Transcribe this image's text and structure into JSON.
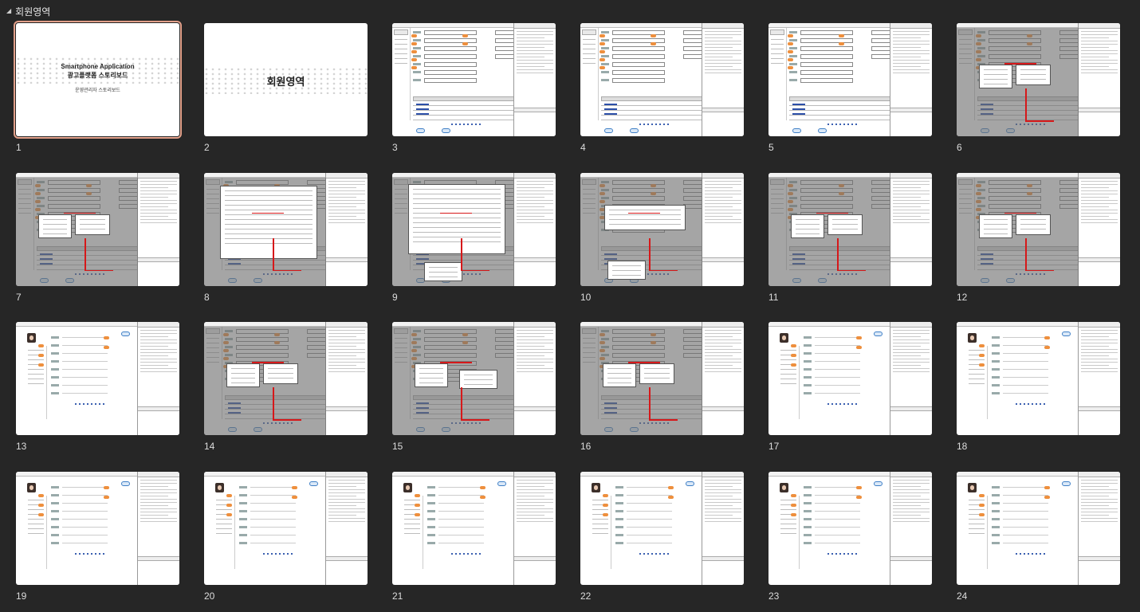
{
  "section": {
    "title": "회원영역",
    "collapse_glyph": "◢"
  },
  "title_slides": {
    "s1": {
      "line1": "Smartphone Application",
      "line2": "광고플랫폼 스토리보드",
      "line3": "운영관리자 스토리보드"
    },
    "s2": {
      "title": "회원영역"
    }
  },
  "slides": [
    {
      "n": "1",
      "kind": "title1"
    },
    {
      "n": "2",
      "kind": "title2"
    },
    {
      "n": "3",
      "kind": "form"
    },
    {
      "n": "4",
      "kind": "form"
    },
    {
      "n": "5",
      "kind": "form"
    },
    {
      "n": "6",
      "kind": "overlay"
    },
    {
      "n": "7",
      "kind": "overlay"
    },
    {
      "n": "8",
      "kind": "overlay"
    },
    {
      "n": "9",
      "kind": "overlay"
    },
    {
      "n": "10",
      "kind": "overlay"
    },
    {
      "n": "11",
      "kind": "overlay"
    },
    {
      "n": "12",
      "kind": "overlay"
    },
    {
      "n": "13",
      "kind": "profile"
    },
    {
      "n": "14",
      "kind": "overlay"
    },
    {
      "n": "15",
      "kind": "overlay"
    },
    {
      "n": "16",
      "kind": "overlay"
    },
    {
      "n": "17",
      "kind": "profile"
    },
    {
      "n": "18",
      "kind": "profile"
    },
    {
      "n": "19",
      "kind": "profile"
    },
    {
      "n": "20",
      "kind": "profile"
    },
    {
      "n": "21",
      "kind": "profile"
    },
    {
      "n": "22",
      "kind": "profile"
    },
    {
      "n": "23",
      "kind": "profile"
    },
    {
      "n": "24",
      "kind": "profile"
    }
  ],
  "selected_slide": "1",
  "colors": {
    "background": "#262626",
    "selection": "#e2a08a",
    "accent_orange": "#ee8f3d",
    "accent_blue": "#3f7fc6",
    "connector_red": "#d6181a"
  }
}
